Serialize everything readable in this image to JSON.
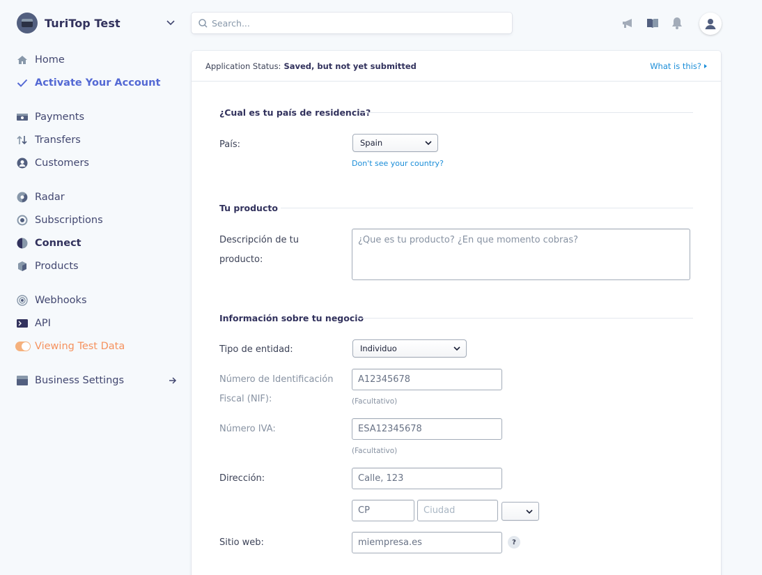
{
  "account": {
    "name": "TuriTop Test"
  },
  "sidebar": {
    "items": [
      {
        "label": "Home"
      },
      {
        "label": "Activate Your Account"
      },
      {
        "label": "Payments"
      },
      {
        "label": "Transfers"
      },
      {
        "label": "Customers"
      },
      {
        "label": "Radar"
      },
      {
        "label": "Subscriptions"
      },
      {
        "label": "Connect"
      },
      {
        "label": "Products"
      },
      {
        "label": "Webhooks"
      },
      {
        "label": "API"
      },
      {
        "label": "Viewing Test Data"
      },
      {
        "label": "Business Settings"
      }
    ]
  },
  "search": {
    "placeholder": "Search..."
  },
  "status": {
    "label": "Application Status:",
    "value": "Saved, but not yet submitted",
    "help": "What is this?"
  },
  "sections": {
    "residence": {
      "title": "¿Cual es tu país de residencia?",
      "country_label": "País:",
      "country_value": "Spain",
      "country_link": "Don't see your country?"
    },
    "product": {
      "title": "Tu producto",
      "description_label_1": "Descripción de tu",
      "description_label_2": "producto:",
      "description_placeholder": "¿Que es tu producto? ¿En que momento cobras?"
    },
    "business": {
      "title": "Información sobre tu negocio",
      "entity_label": "Tipo de entidad:",
      "entity_value": "Individuo",
      "nif_label_1": "Número de Identificación",
      "nif_label_2": "Fiscal (NIF):",
      "nif_value": "A12345678",
      "nif_note": "(Facultativo)",
      "vat_label": "Número IVA:",
      "vat_value": "ESA12345678",
      "vat_note": "(Facultativo)",
      "address_label": "Dirección:",
      "address_value": "Calle, 123",
      "zip_value": "CP",
      "city_placeholder": "Ciudad",
      "website_label": "Sitio web:",
      "website_value": "miempresa.es",
      "help_mark": "?"
    }
  },
  "colors": {
    "accent": "#5469d4",
    "test_mode": "#f5925e",
    "link": "#1a8dd8"
  }
}
